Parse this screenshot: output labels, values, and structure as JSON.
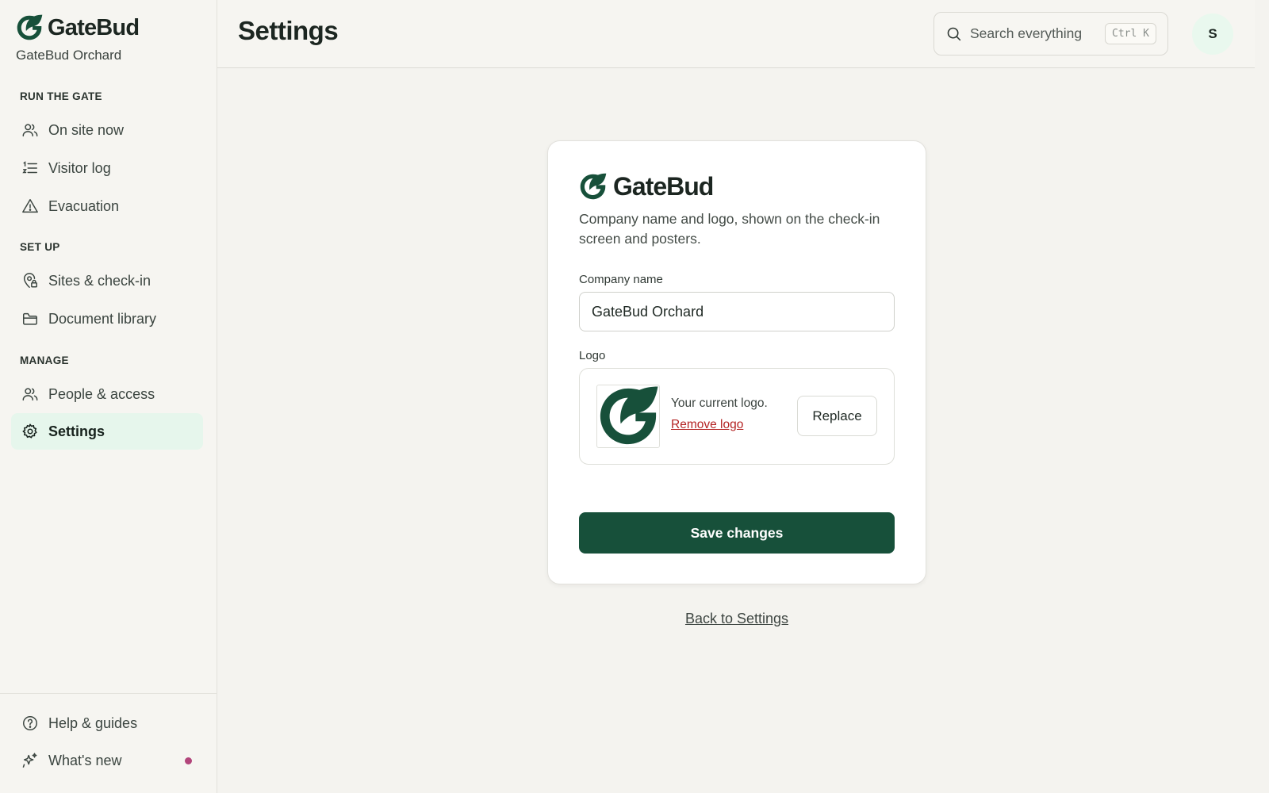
{
  "brand": {
    "name": "GateBud",
    "accent_color": "#17503a"
  },
  "sidebar": {
    "org_name": "GateBud Orchard",
    "sections": [
      {
        "title": "RUN THE GATE",
        "items": [
          {
            "label": "On site now",
            "icon": "people-icon"
          },
          {
            "label": "Visitor log",
            "icon": "list-icon"
          },
          {
            "label": "Evacuation",
            "icon": "warning-icon"
          }
        ]
      },
      {
        "title": "SET UP",
        "items": [
          {
            "label": "Sites & check-in",
            "icon": "location-lock-icon"
          },
          {
            "label": "Document library",
            "icon": "folder-icon"
          }
        ]
      },
      {
        "title": "MANAGE",
        "items": [
          {
            "label": "People & access",
            "icon": "people-icon"
          },
          {
            "label": "Settings",
            "icon": "gear-icon",
            "active": true
          }
        ]
      }
    ],
    "footer": [
      {
        "label": "Help & guides",
        "icon": "help-icon"
      },
      {
        "label": "What's new",
        "icon": "sparkle-icon",
        "has_dot": true
      }
    ]
  },
  "header": {
    "title": "Settings",
    "search": {
      "placeholder": "Search everything",
      "shortcut": "Ctrl K"
    },
    "avatar_initial": "S"
  },
  "card": {
    "brand_name": "GateBud",
    "description": "Company name and logo, shown on the check-in screen and posters.",
    "company_name": {
      "label": "Company name",
      "value": "GateBud Orchard"
    },
    "logo": {
      "label": "Logo",
      "current_text": "Your current logo.",
      "remove_label": "Remove logo",
      "replace_label": "Replace"
    },
    "save_label": "Save changes"
  },
  "back_link": "Back to Settings"
}
